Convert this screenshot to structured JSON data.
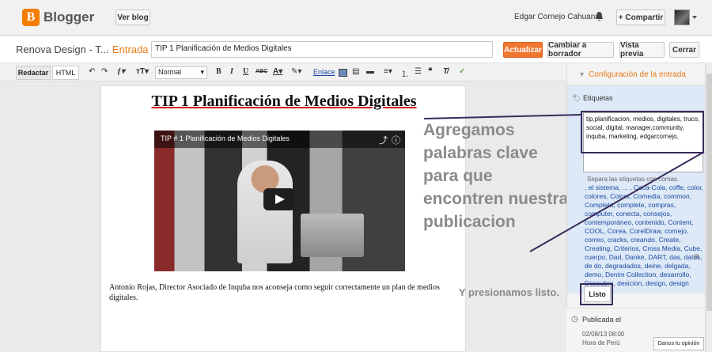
{
  "header": {
    "brand": "Blogger",
    "view_blog": "Ver blog",
    "user_name": "Edgar Cornejo Cahuana",
    "share": "+ Compartir"
  },
  "postbar": {
    "blog_name": "Renova Design - T...",
    "section": "· Entrada",
    "title_value": "TIP 1 Planificación de Medios Digitales",
    "publish": "Actualizar",
    "draft": "Cambiar a borrador",
    "preview": "Vista previa",
    "close": "Cerrar"
  },
  "toolbar": {
    "tab_compose": "Redactar",
    "tab_html": "HTML",
    "font_size_value": "Normal",
    "link_label": "Enlace"
  },
  "editor": {
    "heading": "TIP 1 Planificación de Medios Digitales",
    "video_title": "TIP # 1    Planificación de Medios Digitales",
    "body": "Antonio Rojas, Director Asociado de Inquba nos aconseja como seguir correctamente un plan de medios digitales."
  },
  "annotation": {
    "main": "Agregamos palabras clave para que encontren nuestra publicacion",
    "secondary": "Y presionamos listo."
  },
  "sidebar": {
    "config_title": "Configuración de la entrada",
    "labels_title": "Etiquetas",
    "tags_value": "tip,planificacion, medios, digitales, truco, social, digital, manager,community, inquba, marketing, edgarcornejo,",
    "hint": "Separa las etiquetas con comas.",
    "suggestions": ", el sistema, ... , Coca-Cola, coffe, color, colores, Colors, Comedia, common, Completa, complete, compras, computer, conecta, consejos, contemporáneo, contenido, Content, COOL, Corea, CorelDraw, cornejo, correo, cracks, creando, Create, Creating, Criterios, Cross Media, Cube, cuerpo, Dad, Danke, DART, das, datos, de do, degradados, deine, delgada, demo, Denim Collection, desarrollo, Descubre, desicion, design, design diseño, desing, Detachable, detroit, dev, devamose, developer, develo",
    "done": "Listo",
    "published_title": "Publicada el",
    "published_date": "02/08/13 08:00",
    "timezone": "Hora de Perú"
  },
  "feedback": "Danos tu opinión"
}
